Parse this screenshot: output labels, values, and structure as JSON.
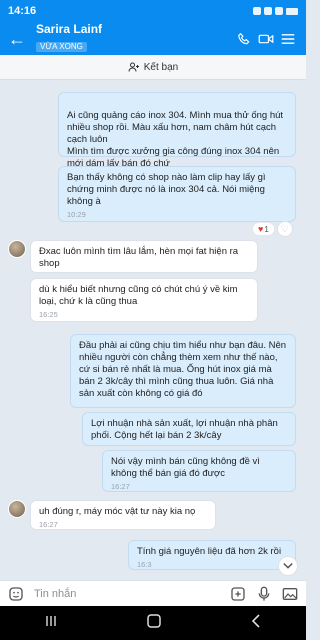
{
  "status": {
    "time": "14:16"
  },
  "header": {
    "title": "Sarira Lainf",
    "subtitle": "VỪA XONG"
  },
  "friend_bar": {
    "label": "Kết bạn"
  },
  "messages": [
    {
      "text": "Ai cũng quảng cáo inox 304. Mình mua thử ống hút nhiều shop rồi. Màu xấu hơn, nam châm hút cạch cạch luôn\nMình tìm được xưởng gia công đúng inox 304 nên mới dám lấy bán đó chứ",
      "time": ""
    },
    {
      "text": "Bạn thấy không có shop nào làm clip hay lấy gì chứng minh được nó là inox 304 cả. Nói miệng không à",
      "time": "10:29"
    },
    {
      "text": "Đxac luôn mình tìm lâu lắm, hèn mọi fat hiện ra shop",
      "time": ""
    },
    {
      "text": "dù k hiểu biết nhưng cũng có chút chú ý về kim loại, chứ k là cũng thua",
      "time": "16:25"
    },
    {
      "text": "Đầu phải ai cũng chịu tìm hiểu như bạn đâu. Nên nhiều người còn chẳng thèm xem như thế nào, cứ si bán rẻ nhất là mua. Ống hút inox giá mà bán 2 3k/cây thì mình cũng thua luôn. Giá nhà sản xuất còn không có giá đó",
      "time": ""
    },
    {
      "text": "Lợi nhuận nhà sản xuất, lợi nhuận nhà phân phối. Cộng hết lại bán 2 3k/cây",
      "time": ""
    },
    {
      "text": "Nói vậy mình bán cũng không đề vì không thể bán giá đó được",
      "time": "16:27"
    },
    {
      "text": "uh đúng r, máy móc vật tư này kia nọ",
      "time": "16:27"
    },
    {
      "text": "Tính giá nguyên liệu đã hơn 2k rồi",
      "time": "16:3"
    }
  ],
  "reaction": {
    "emoji": "♥",
    "count": "1"
  },
  "input": {
    "placeholder": "Tin nhắn"
  },
  "colors": {
    "brand": "#0a8bf0",
    "outgoing_bubble": "#d9edfd",
    "incoming_bubble": "#ffffff",
    "chat_background": "#e2e9f1"
  }
}
